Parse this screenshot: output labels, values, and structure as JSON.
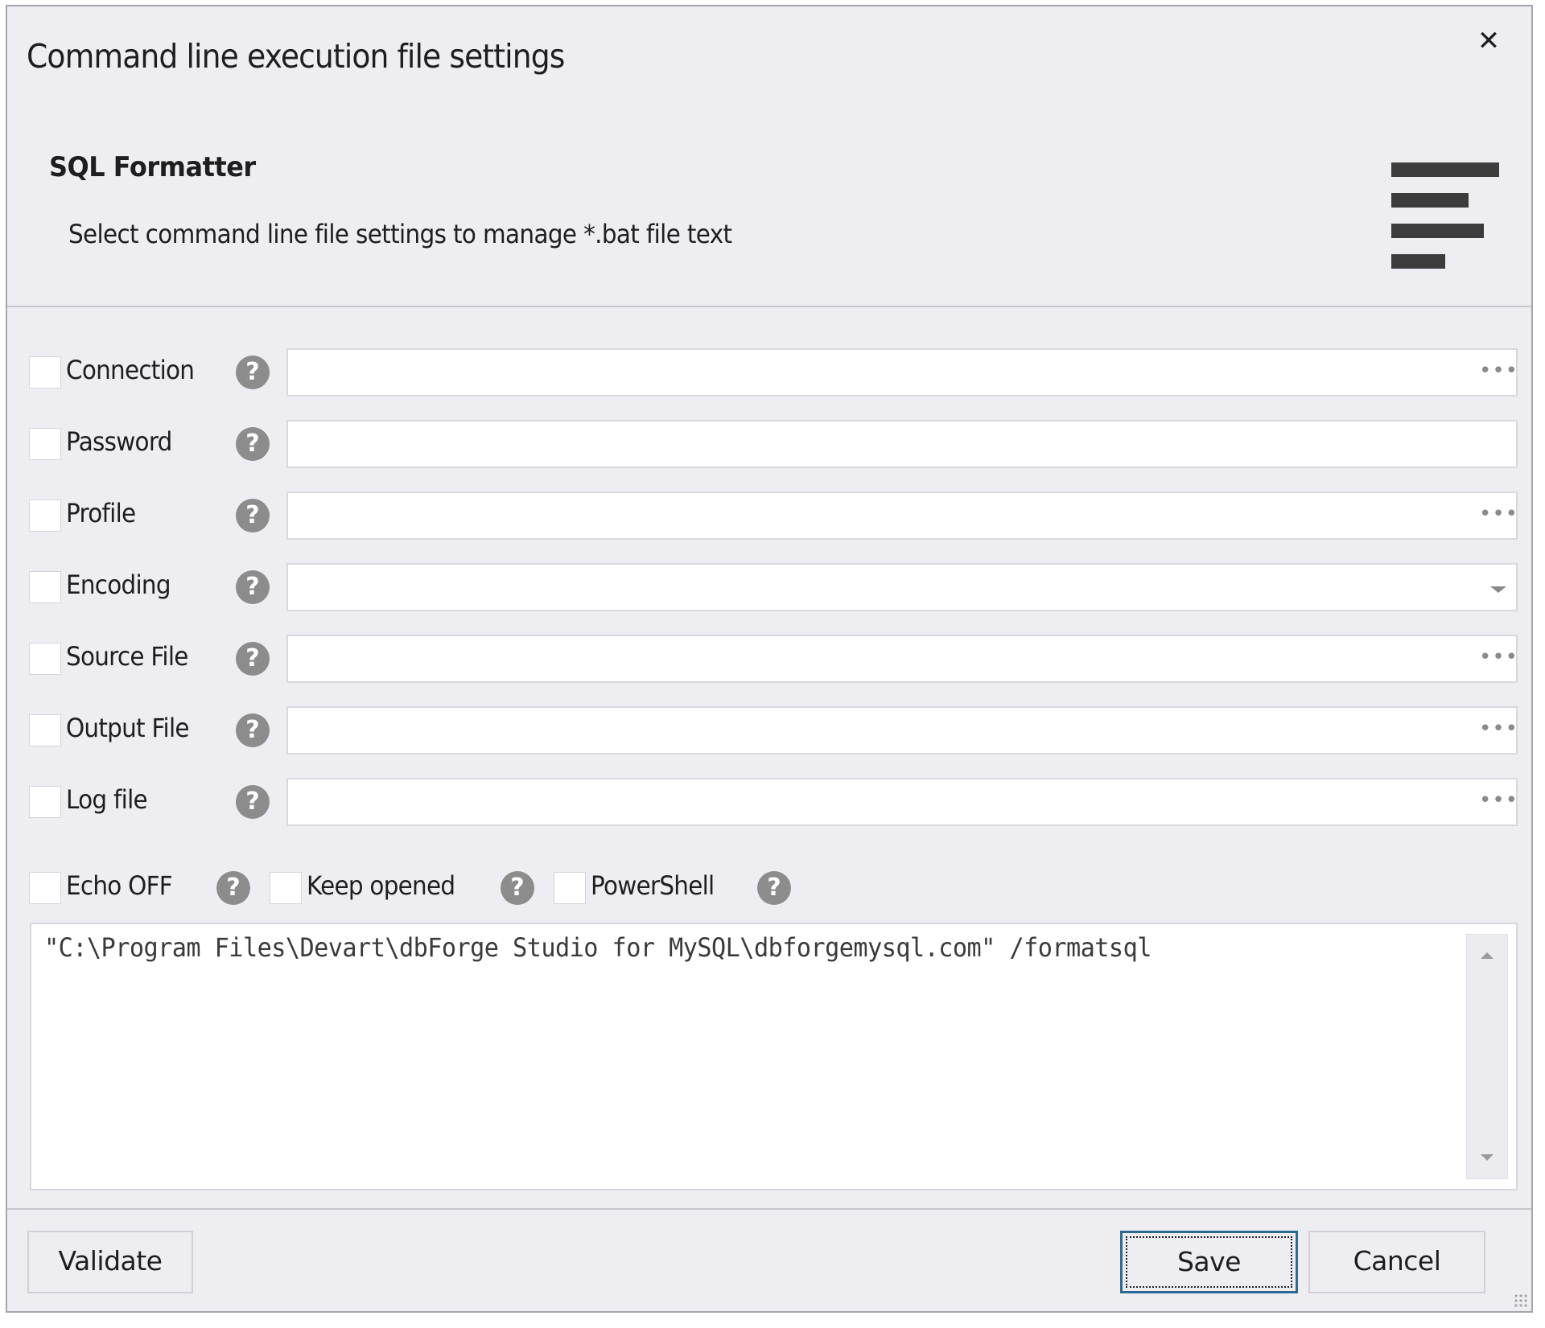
{
  "dialog": {
    "title": "Command line execution file settings",
    "close_icon": "close-icon"
  },
  "header": {
    "title": "SQL Formatter",
    "description": "Select command line file settings to manage *.bat file text",
    "icon": "align-left-icon"
  },
  "fields": [
    {
      "label": "Connection",
      "value": "",
      "checked": false,
      "button": "ellipsis"
    },
    {
      "label": "Password",
      "value": "",
      "checked": false,
      "button": "none"
    },
    {
      "label": "Profile",
      "value": "",
      "checked": false,
      "button": "ellipsis"
    },
    {
      "label": "Encoding",
      "value": "",
      "checked": false,
      "button": "dropdown"
    },
    {
      "label": "Source File",
      "value": "",
      "checked": false,
      "button": "ellipsis"
    },
    {
      "label": "Output File",
      "value": "",
      "checked": false,
      "button": "ellipsis"
    },
    {
      "label": "Log file",
      "value": "",
      "checked": false,
      "button": "ellipsis"
    }
  ],
  "ellipsis_glyph": "•••",
  "help_glyph": "?",
  "options": [
    {
      "label": "Echo OFF",
      "checked": false
    },
    {
      "label": "Keep opened",
      "checked": false
    },
    {
      "label": "PowerShell",
      "checked": false
    }
  ],
  "command_text": "\"C:\\Program Files\\Devart\\dbForge Studio for MySQL\\dbforgemysql.com\" /formatsql",
  "footer": {
    "validate_label": "Validate",
    "save_label": "Save",
    "cancel_label": "Cancel"
  }
}
